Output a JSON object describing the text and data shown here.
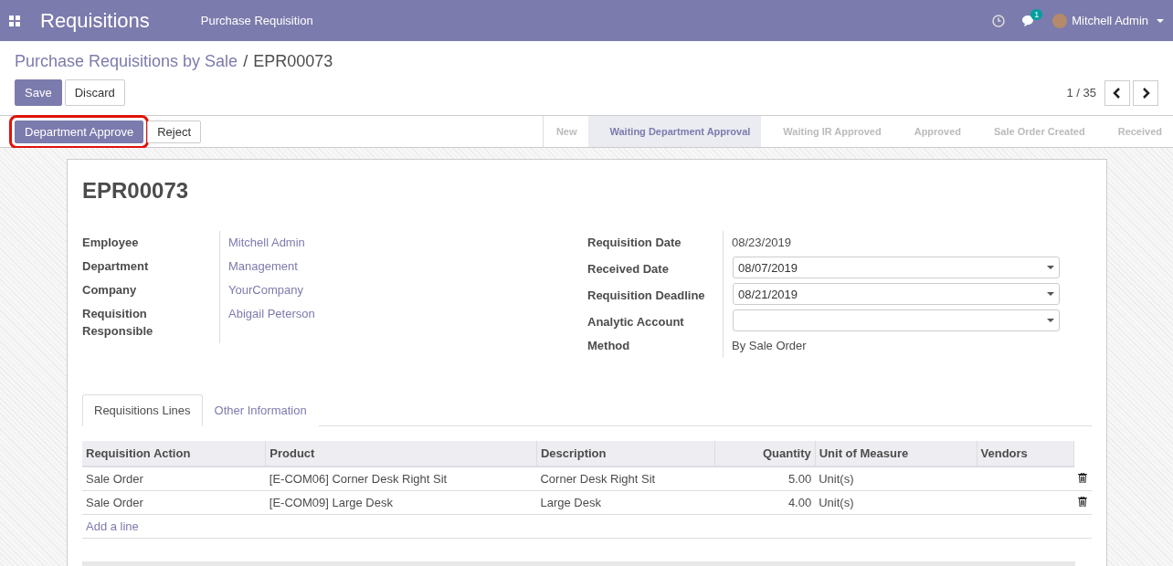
{
  "navbar": {
    "app_title": "Requisitions",
    "menu": [
      "Purchase Requisition"
    ],
    "message_count": "1",
    "user": "Mitchell Admin"
  },
  "breadcrumb": {
    "parent": "Purchase Requisitions by Sale",
    "separator": "/",
    "current": "EPR00073"
  },
  "buttons": [
    {
      "label": "Save",
      "kind": "primary"
    },
    {
      "label": "Discard",
      "kind": "secondary"
    }
  ],
  "pager": "1 / 35",
  "actions": [
    {
      "label": "Department Approve",
      "kind": "primary",
      "highlighted": true
    },
    {
      "label": "Reject",
      "kind": "secondary",
      "highlighted": false
    }
  ],
  "stages": [
    {
      "label": "New",
      "selected": false
    },
    {
      "label": "Waiting Department Approval",
      "selected": true
    },
    {
      "label": "Waiting IR Approved",
      "selected": false
    },
    {
      "label": "Approved",
      "selected": false
    },
    {
      "label": "Sale Order Created",
      "selected": false
    },
    {
      "label": "Received",
      "selected": false
    }
  ],
  "sheet": {
    "title": "EPR00073",
    "left_fields": [
      {
        "label": "Employee",
        "value": "Mitchell Admin"
      },
      {
        "label": "Department",
        "value": "Management"
      },
      {
        "label": "Company",
        "value": "YourCompany"
      },
      {
        "label": "Requisition Responsible",
        "value": "Abigail Peterson"
      }
    ],
    "right_fields": [
      {
        "label": "Requisition Date",
        "value": "08/23/2019",
        "kind": "text"
      },
      {
        "label": "Received Date",
        "value": "08/07/2019",
        "kind": "select"
      },
      {
        "label": "Requisition Deadline",
        "value": "08/21/2019",
        "kind": "select"
      },
      {
        "label": "Analytic Account",
        "kind": "select"
      },
      {
        "label": "Method",
        "value": "By Sale Order",
        "kind": "text"
      }
    ],
    "tabs": [
      {
        "label": "Requisitions Lines",
        "selected": true
      },
      {
        "label": "Other Information",
        "selected": false
      }
    ],
    "table": {
      "columns": [
        "Requisition Action",
        "Product",
        "Description",
        "Quantity",
        "Unit of Measure",
        "Vendors"
      ],
      "rows": [
        [
          "Sale Order",
          "[E-COM06] Corner Desk Right Sit",
          "Corner Desk Right Sit",
          "5.00",
          "Unit(s)",
          ""
        ],
        [
          "Sale Order",
          "[E-COM09] Large Desk",
          "Large Desk",
          "4.00",
          "Unit(s)",
          ""
        ]
      ],
      "add_line": "Add a line"
    }
  }
}
